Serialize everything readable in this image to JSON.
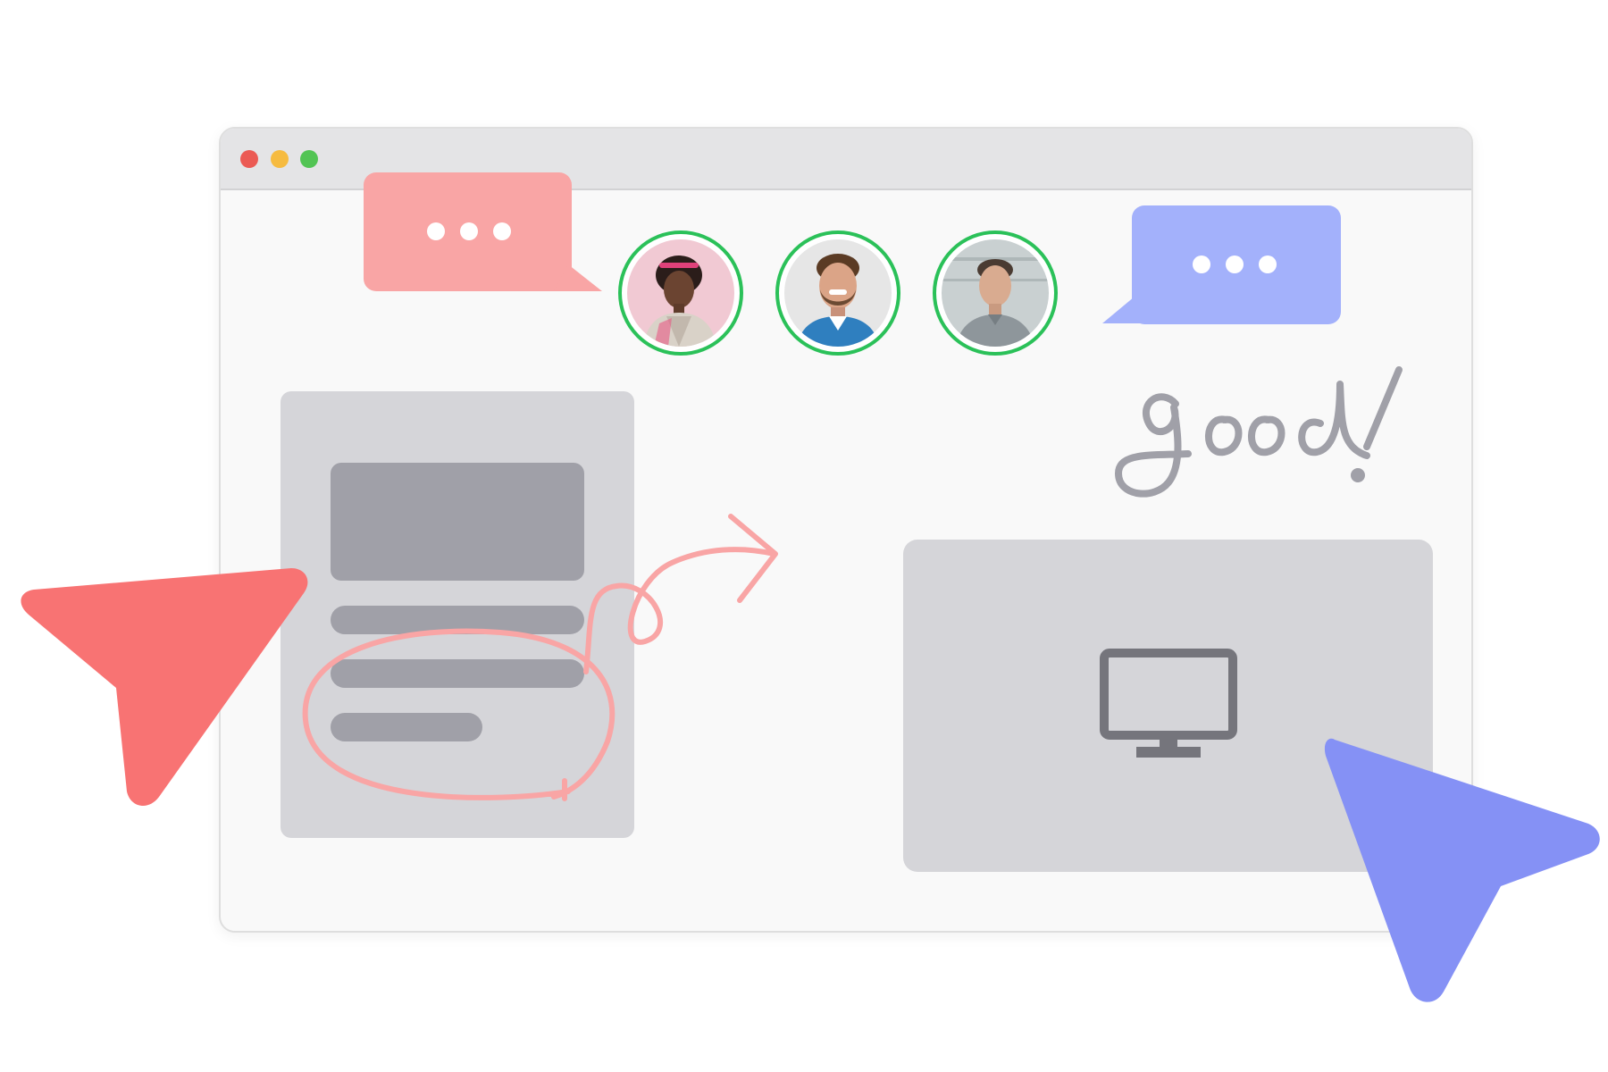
{
  "window": {
    "traffic_lights": [
      {
        "name": "close",
        "color": "#eb5a54"
      },
      {
        "name": "minimize",
        "color": "#f6bb40"
      },
      {
        "name": "maximize",
        "color": "#52c454"
      }
    ]
  },
  "chat_bubbles": [
    {
      "who": "left-collaborator",
      "color": "#f9a5a5",
      "content": "typing-dots-icon"
    },
    {
      "who": "right-collaborator",
      "color": "#a3b1fb",
      "content": "typing-dots-icon"
    }
  ],
  "avatars": [
    {
      "icon": "user-photo-woman-icon",
      "status_color": "#2bc159"
    },
    {
      "icon": "user-photo-man-smiling-icon",
      "status_color": "#2bc159"
    },
    {
      "icon": "user-photo-man-icon",
      "status_color": "#2bc159"
    }
  ],
  "annotation": {
    "handwritten_text": "good!",
    "ink_color": "#a0a0a8",
    "pen_color": "#f9a5a5"
  },
  "media_card": {
    "icon": "monitor-icon",
    "icon_color": "#75757c"
  },
  "cursors": [
    {
      "name": "red-cursor-icon",
      "color": "#f87373"
    },
    {
      "name": "blue-cursor-icon",
      "color": "#8591f5"
    }
  ],
  "colors": {
    "window_bg": "#f9f9f9",
    "titlebar_bg": "#e4e4e6",
    "card_bg": "#d5d5d9",
    "placeholder_block": "#a0a0a8"
  }
}
